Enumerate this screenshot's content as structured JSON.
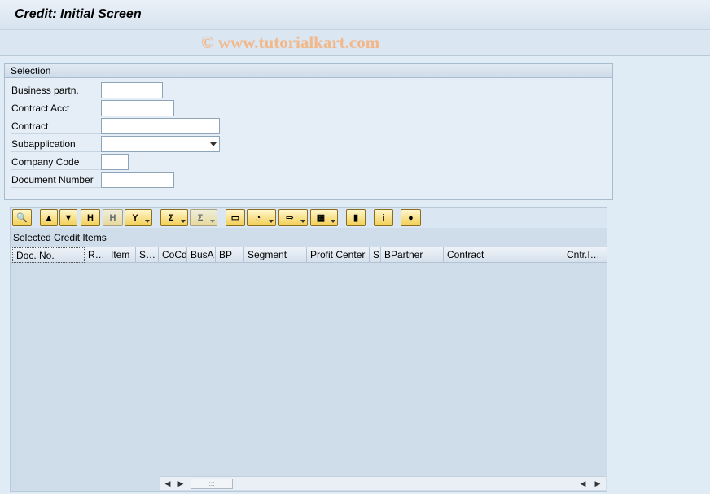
{
  "window": {
    "title": "Credit: Initial Screen",
    "watermark": "© www.tutorialkart.com"
  },
  "selection": {
    "heading": "Selection",
    "fields": [
      {
        "label": "Business partn.",
        "value": ""
      },
      {
        "label": "Contract Acct",
        "value": ""
      },
      {
        "label": "Contract",
        "value": ""
      },
      {
        "label": "Subapplication",
        "value": ""
      },
      {
        "label": "Company Code",
        "value": ""
      },
      {
        "label": "Document Number",
        "value": ""
      }
    ]
  },
  "grid": {
    "title": "Selected Credit Items",
    "toolbar": [
      {
        "icon": "details-icon",
        "glyph": "🔍"
      },
      {
        "icon": "sort-ascending-icon",
        "glyph": "▲"
      },
      {
        "icon": "sort-descending-icon",
        "glyph": "▼"
      },
      {
        "icon": "find-icon",
        "glyph": "H"
      },
      {
        "icon": "find-next-icon",
        "glyph": "H"
      },
      {
        "icon": "filter-icon",
        "glyph": "Y"
      },
      {
        "icon": "sum-icon",
        "glyph": "Σ"
      },
      {
        "icon": "subtotal-icon",
        "glyph": "Σ"
      },
      {
        "icon": "print-preview-icon",
        "glyph": "▭"
      },
      {
        "icon": "export-icon",
        "glyph": "◔"
      },
      {
        "icon": "local-file-icon",
        "glyph": "⇨"
      },
      {
        "icon": "layout-icon",
        "glyph": "▦"
      },
      {
        "icon": "graphic-icon",
        "glyph": "▮"
      },
      {
        "icon": "info-icon",
        "glyph": "i"
      },
      {
        "icon": "color-wheel-icon",
        "glyph": "●"
      }
    ],
    "columns": [
      "Doc. No.",
      "R…",
      "Item",
      "S…",
      "CoCd",
      "BusA",
      "BP",
      "Segment",
      "Profit Center",
      "S",
      "BPartner",
      "Contract",
      "Cntr.I…"
    ],
    "rows": []
  },
  "scroll": {
    "thumb": ":::"
  }
}
